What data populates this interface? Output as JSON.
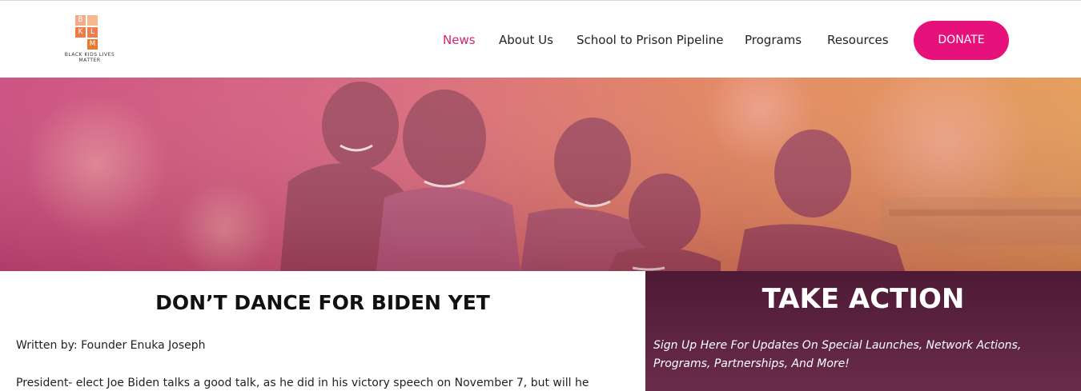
{
  "logo": {
    "letters": [
      "B",
      "L",
      "K",
      "M"
    ],
    "caption_line1": "BLACK KIDS LIVES",
    "caption_line2": "MATTER",
    "colors": [
      "#f4a98b",
      "#ef7d52",
      "#f07a43",
      "#e8792f"
    ]
  },
  "nav": {
    "items": [
      {
        "label": "News",
        "active": true
      },
      {
        "label": "About Us",
        "active": false
      },
      {
        "label": "School to Prison Pipeline",
        "active": false
      },
      {
        "label": "Programs",
        "active": false
      },
      {
        "label": "Resources",
        "active": false
      }
    ],
    "donate_label": "DONATE"
  },
  "hero": {
    "image": "photo-of-smiling-children",
    "overlay_colors": [
      "#d24d80",
      "#e2814e"
    ]
  },
  "article": {
    "title": "DON’T DANCE FOR BIDEN YET",
    "byline": "Written by: Founder Enuka Joseph",
    "body": "President- elect Joe Biden talks a good talk, as he did in his victory speech on November 7, but will he"
  },
  "take_action": {
    "title": "TAKE ACTION",
    "text": "Sign Up Here For Updates On Special Launches, Network Actions, Programs, Partnerships, And More!"
  },
  "colors": {
    "accent": "#e6117a",
    "nav_active": "#d6246e",
    "panel": "#4d1a36"
  }
}
